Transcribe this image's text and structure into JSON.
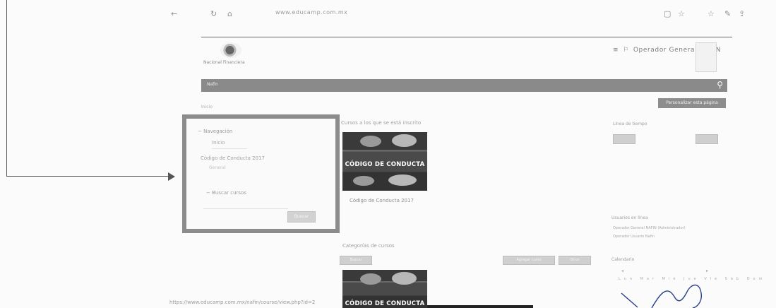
{
  "browser": {
    "url": "www.educamp.com.mx"
  },
  "header": {
    "logo_text": "Nacional Financiera",
    "user_name": "Operador General NAFIN"
  },
  "navbar": {
    "item": "Nafin"
  },
  "page": {
    "breadcrumb": "Inicio",
    "customize_button": "Personalizar esta página"
  },
  "navigation_block": {
    "title": "Navegación",
    "home": "Inicio",
    "course": "Código de Conducta 2017",
    "sub": "General",
    "search_label": "Buscar cursos",
    "search_button": "Buscar"
  },
  "courses": {
    "section_title": "Cursos a los que se está inscrito",
    "banner_text": "CÓDIGO DE CONDUCTA",
    "course_link": "Código de Conducta 2017",
    "section2_title": "Categorías de cursos",
    "buttons": [
      "Buscar",
      "Agregar curso",
      "Otros"
    ]
  },
  "right_column": {
    "block1": "Línea de tiempo",
    "block2": "Usuarios en línea",
    "block2_line1": "Operador General NAFIN (Administrador)",
    "block2_line2": "Operador Usuario Nafin",
    "block3": "Calendario",
    "cal_days": "Lun Mar Mié Jue Vie Sáb Dom"
  },
  "status_bar": {
    "url": "https://www.educamp.com.mx/nafin/course/view.php?id=2"
  },
  "colors": {
    "highlight_border": "#8c8c8c",
    "navbar": "#8a8a8a"
  }
}
